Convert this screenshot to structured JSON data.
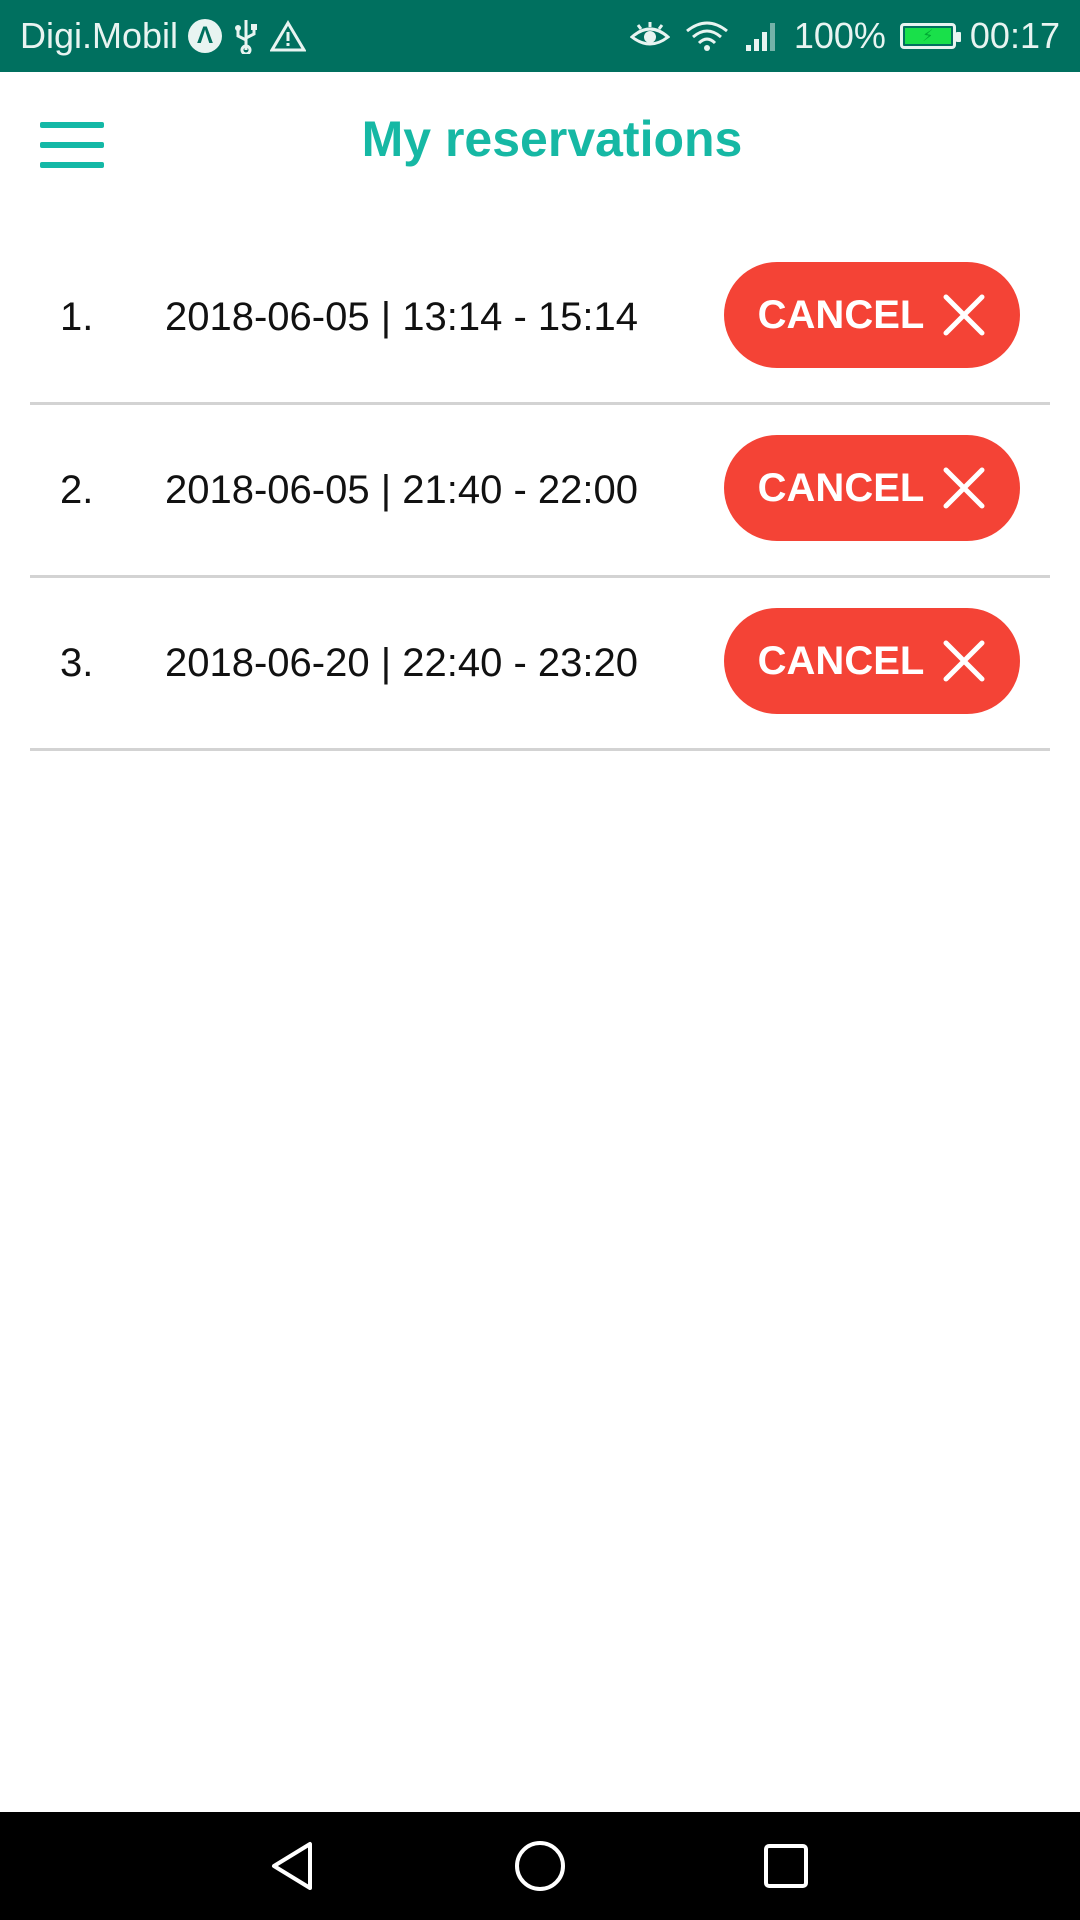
{
  "status_bar": {
    "carrier": "Digi.Mobil",
    "carrier_badge": "Λ",
    "battery_percent": "100%",
    "time": "00:17",
    "icons": [
      "usb-icon",
      "warning-icon",
      "eye-icon",
      "wifi-icon",
      "signal-icon",
      "battery-charging-icon"
    ]
  },
  "header": {
    "title": "My reservations",
    "menu_icon": "hamburger-menu-icon"
  },
  "reservations": [
    {
      "index": "1.",
      "time": "2018-06-05 | 13:14 - 15:14",
      "action_label": "CANCEL"
    },
    {
      "index": "2.",
      "time": "2018-06-05 | 21:40 - 22:00",
      "action_label": "CANCEL"
    },
    {
      "index": "3.",
      "time": "2018-06-20 | 22:40 - 23:20",
      "action_label": "CANCEL"
    }
  ],
  "nav_bar": {
    "icons": [
      "back-icon",
      "home-icon",
      "recents-icon"
    ]
  },
  "colors": {
    "status_bar": "#00705F",
    "accent": "#16B8A4",
    "cancel_button": "#F44336",
    "divider": "#D3D3D3",
    "nav_bar": "#000000"
  }
}
